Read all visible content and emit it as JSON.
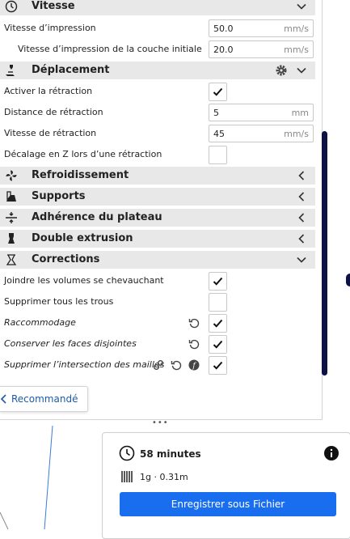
{
  "settings": {
    "vitesse": {
      "title": "Vitesse",
      "icon": "clock-icon",
      "rows": [
        {
          "label": "Vitesse d’impression",
          "value": "50.0",
          "unit": "mm/s"
        },
        {
          "label": "Vitesse d’impression de la couche initiale",
          "value": "20.0",
          "unit": "mm/s"
        }
      ]
    },
    "deplacement": {
      "title": "Déplacement",
      "icon": "travel-icon",
      "rows": [
        {
          "label": "Activer la rétraction",
          "checked": true
        },
        {
          "label": "Distance de rétraction",
          "value": "5",
          "unit": "mm"
        },
        {
          "label": "Vitesse de rétraction",
          "value": "45",
          "unit": "mm/s"
        },
        {
          "label": "Décalage en Z lors d’une rétraction",
          "checked": false
        }
      ]
    },
    "collapsed": [
      {
        "title": "Refroidissement",
        "icon": "fan-icon"
      },
      {
        "title": "Supports",
        "icon": "support-icon"
      },
      {
        "title": "Adhérence du plateau",
        "icon": "adhesion-icon"
      },
      {
        "title": "Double extrusion",
        "icon": "dual-extrusion-icon"
      }
    ],
    "corrections": {
      "title": "Corrections",
      "icon": "corrections-icon",
      "rows": [
        {
          "label": "Joindre les volumes se chevauchant",
          "checked": true
        },
        {
          "label": "Supprimer tous les trous",
          "checked": false
        },
        {
          "label": "Raccommodage",
          "checked": true
        },
        {
          "label": "Conserver les faces disjointes",
          "checked": true
        },
        {
          "label": "Supprimer l’intersection des mailles",
          "checked": true
        }
      ]
    }
  },
  "recommended_button": "Recommandé",
  "print": {
    "time": "58 minutes",
    "material": "1g · 0.31m",
    "save_button": "Enregistrer sous Fichier"
  },
  "colors": {
    "accent": "#196ef0",
    "scrollbar": "#0d1144",
    "category_bg": "#e8e8e8"
  }
}
